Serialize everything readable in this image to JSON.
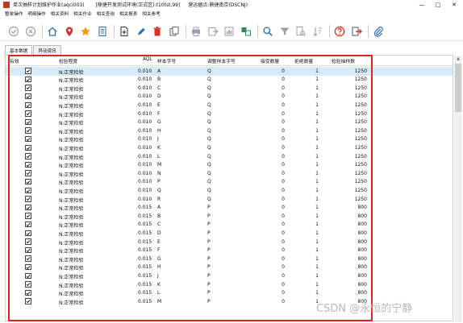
{
  "window": {
    "title_parts": [
      "单次抽样计划维护作业(aqci003)",
      "[鼎捷开发测试环境(正式区):t10tst,99]",
      "营运据点:鼎捷南京(DSCNJ)"
    ],
    "controls": [
      "—",
      "□",
      "✕"
    ]
  },
  "menu": [
    "整单操作",
    "明细操作",
    "相关资料",
    "相关作业",
    "相关查询",
    "相关报表",
    "相关参考"
  ],
  "toolbar": [
    {
      "name": "confirm-icon",
      "color": "#9aa1a8"
    },
    {
      "name": "cancel-icon",
      "color": "#9aa1a8"
    },
    {
      "name": "home-icon",
      "color": "#2f6fb5"
    },
    {
      "name": "location-pin-icon",
      "color": "#d93025"
    },
    {
      "name": "star-icon",
      "color": "#f39c12"
    },
    {
      "name": "list-icon",
      "color": "#3b6ea5"
    },
    {
      "name": "new-icon",
      "color": "#333333"
    },
    {
      "name": "edit-icon",
      "color": "#2f6fb5"
    },
    {
      "name": "delete-icon",
      "color": "#d93025"
    },
    {
      "name": "copy-icon",
      "color": "#666666"
    },
    {
      "name": "print-icon",
      "color": "#9aa1a8"
    },
    {
      "name": "export-icon",
      "color": "#9aa1a8"
    },
    {
      "name": "report-icon",
      "color": "#9aa1a8"
    },
    {
      "name": "query-icon",
      "color": "#2e8b57"
    },
    {
      "name": "search-icon",
      "color": "#2f6fb5"
    },
    {
      "name": "filter-icon",
      "color": "#9aa1a8"
    },
    {
      "name": "document-search-icon",
      "color": "#9aa1a8"
    },
    {
      "name": "sort-icon",
      "color": "#9aa1a8"
    },
    {
      "name": "help-icon",
      "color": "#d93025"
    },
    {
      "name": "exit-icon",
      "color": "#d93025"
    },
    {
      "name": "attachment-icon",
      "color": "#2f6fb5"
    }
  ],
  "tabs": [
    "基本数据",
    "异动资讯"
  ],
  "columns": [
    "有效",
    "检验程度",
    "AQL",
    "样本字号",
    "调整样本字号",
    "接受数量",
    "拒绝数量",
    "检验抽样数"
  ],
  "rows": [
    [
      "N:正常检验",
      "0.010",
      "A",
      "Q",
      "0",
      "1",
      "1250"
    ],
    [
      "N:正常检验",
      "0.010",
      "B",
      "Q",
      "0",
      "1",
      "1250"
    ],
    [
      "N:正常检验",
      "0.010",
      "C",
      "Q",
      "0",
      "1",
      "1250"
    ],
    [
      "N:正常检验",
      "0.010",
      "D",
      "Q",
      "0",
      "1",
      "1250"
    ],
    [
      "N:正常检验",
      "0.010",
      "E",
      "Q",
      "0",
      "1",
      "1250"
    ],
    [
      "N:正常检验",
      "0.010",
      "F",
      "Q",
      "0",
      "1",
      "1250"
    ],
    [
      "N:正常检验",
      "0.010",
      "G",
      "Q",
      "0",
      "1",
      "1250"
    ],
    [
      "N:正常检验",
      "0.010",
      "H",
      "Q",
      "0",
      "1",
      "1250"
    ],
    [
      "N:正常检验",
      "0.010",
      "J",
      "Q",
      "0",
      "1",
      "1250"
    ],
    [
      "N:正常检验",
      "0.010",
      "K",
      "Q",
      "0",
      "1",
      "1250"
    ],
    [
      "N:正常检验",
      "0.010",
      "L",
      "Q",
      "0",
      "1",
      "1250"
    ],
    [
      "N:正常检验",
      "0.010",
      "M",
      "Q",
      "0",
      "1",
      "1250"
    ],
    [
      "N:正常检验",
      "0.010",
      "N",
      "Q",
      "0",
      "1",
      "1250"
    ],
    [
      "N:正常检验",
      "0.010",
      "P",
      "Q",
      "0",
      "1",
      "1250"
    ],
    [
      "N:正常检验",
      "0.010",
      "Q",
      "Q",
      "0",
      "1",
      "1250"
    ],
    [
      "N:正常检验",
      "0.010",
      "R",
      "Q",
      "0",
      "1",
      "1250"
    ],
    [
      "N:正常检验",
      "0.015",
      "A",
      "P",
      "0",
      "1",
      "800"
    ],
    [
      "N:正常检验",
      "0.015",
      "B",
      "P",
      "0",
      "1",
      "800"
    ],
    [
      "N:正常检验",
      "0.015",
      "C",
      "P",
      "0",
      "1",
      "800"
    ],
    [
      "N:正常检验",
      "0.015",
      "D",
      "P",
      "0",
      "1",
      "800"
    ],
    [
      "N:正常检验",
      "0.015",
      "E",
      "P",
      "0",
      "1",
      "800"
    ],
    [
      "N:正常检验",
      "0.015",
      "F",
      "P",
      "0",
      "1",
      "800"
    ],
    [
      "N:正常检验",
      "0.015",
      "G",
      "P",
      "0",
      "1",
      "800"
    ],
    [
      "N:正常检验",
      "0.015",
      "H",
      "P",
      "0",
      "1",
      "800"
    ],
    [
      "N:正常检验",
      "0.015",
      "J",
      "P",
      "0",
      "1",
      "800"
    ],
    [
      "N:正常检验",
      "0.015",
      "K",
      "P",
      "0",
      "1",
      "800"
    ],
    [
      "N:正常检验",
      "0.015",
      "L",
      "P",
      "0",
      "1",
      "800"
    ],
    [
      "N:正常检验",
      "0.015",
      "M",
      "P",
      "0",
      "1",
      "800"
    ]
  ],
  "watermark": "CSDN @永恒的宁静",
  "colors": {
    "highlight": "#e0251f",
    "selected_row": "#d6e9f7"
  }
}
